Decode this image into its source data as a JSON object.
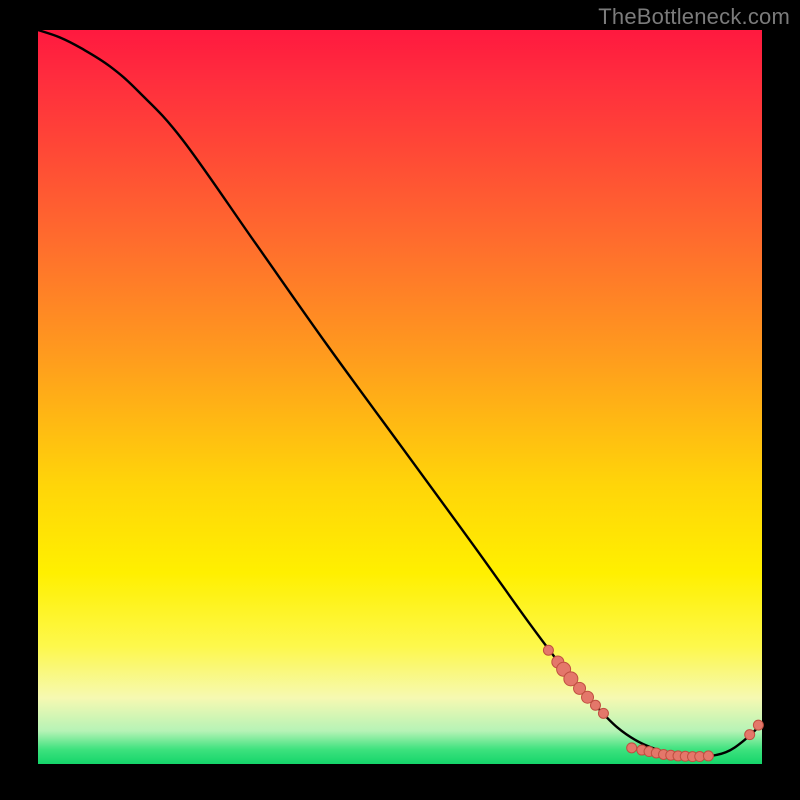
{
  "attribution": "TheBottleneck.com",
  "colors": {
    "dot_fill": "#e4776a",
    "dot_stroke": "#c04f41",
    "curve": "#000000",
    "attribution": "#7b7b7b"
  },
  "chart_data": {
    "type": "line",
    "title": "",
    "xlabel": "",
    "ylabel": "",
    "xlim": [
      0,
      100
    ],
    "ylim": [
      0,
      100
    ],
    "series": [
      {
        "name": "curve",
        "x": [
          0,
          3,
          6,
          10,
          14,
          20,
          30,
          40,
          50,
          60,
          68,
          73,
          77,
          80,
          83,
          86,
          89,
          92,
          95,
          97.5,
          100
        ],
        "y": [
          100,
          99,
          97.5,
          95,
          91.5,
          85,
          71,
          57,
          43.5,
          30,
          19,
          12.5,
          8,
          5,
          3,
          1.8,
          1.1,
          1.0,
          1.6,
          3.2,
          5.5
        ]
      }
    ],
    "points_clusters": [
      {
        "name": "descending-cluster",
        "points": [
          {
            "x": 70.5,
            "y": 15.5,
            "size": "small"
          },
          {
            "x": 71.8,
            "y": 13.9,
            "size": "med"
          },
          {
            "x": 72.6,
            "y": 12.9,
            "size": "big"
          },
          {
            "x": 73.6,
            "y": 11.6,
            "size": "big"
          },
          {
            "x": 74.8,
            "y": 10.3,
            "size": "med"
          },
          {
            "x": 75.9,
            "y": 9.1,
            "size": "med"
          },
          {
            "x": 77.0,
            "y": 8.0,
            "size": "small"
          },
          {
            "x": 78.1,
            "y": 6.9,
            "size": "small"
          }
        ]
      },
      {
        "name": "bottom-run",
        "label": "",
        "points": [
          {
            "x": 82.0,
            "y": 2.2,
            "size": "small"
          },
          {
            "x": 83.4,
            "y": 1.9,
            "size": "small"
          },
          {
            "x": 84.4,
            "y": 1.7,
            "size": "small"
          },
          {
            "x": 85.4,
            "y": 1.5,
            "size": "small"
          },
          {
            "x": 86.4,
            "y": 1.3,
            "size": "small"
          },
          {
            "x": 87.4,
            "y": 1.2,
            "size": "small"
          },
          {
            "x": 88.4,
            "y": 1.1,
            "size": "small"
          },
          {
            "x": 89.4,
            "y": 1.05,
            "size": "small"
          },
          {
            "x": 90.4,
            "y": 1.0,
            "size": "small"
          },
          {
            "x": 91.4,
            "y": 1.02,
            "size": "small"
          },
          {
            "x": 92.6,
            "y": 1.1,
            "size": "small"
          }
        ]
      },
      {
        "name": "ascending-pair",
        "points": [
          {
            "x": 98.3,
            "y": 4.0,
            "size": "small"
          },
          {
            "x": 99.5,
            "y": 5.3,
            "size": "small"
          }
        ]
      }
    ]
  }
}
